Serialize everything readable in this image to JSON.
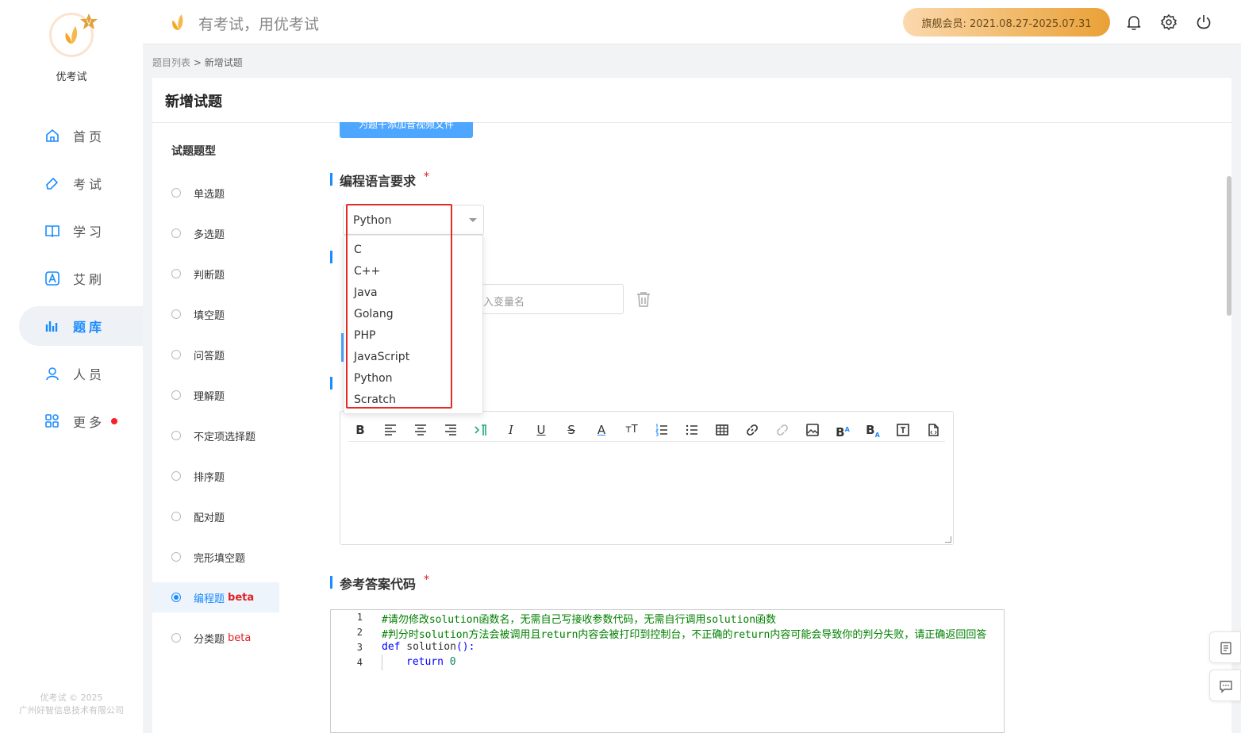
{
  "app": {
    "name": "优考试",
    "slogan": "有考试，用优考试",
    "copyright_line1": "优考试 © 2025",
    "copyright_line2": "广州好智信息技术有限公司",
    "accent_color": "#1a8cff"
  },
  "header": {
    "member_label": "旗舰会员: 2021.08.27-2025.07.31",
    "icons": [
      "bell-icon",
      "gear-icon",
      "power-icon"
    ]
  },
  "sidebar": {
    "items": [
      {
        "label": "首页",
        "icon": "home-icon"
      },
      {
        "label": "考试",
        "icon": "eraser-icon"
      },
      {
        "label": "学习",
        "icon": "book-icon"
      },
      {
        "label": "艾刷",
        "icon": "letter-a-icon"
      },
      {
        "label": "题库",
        "icon": "bar-chart-icon",
        "active": true
      },
      {
        "label": "人员",
        "icon": "user-icon"
      },
      {
        "label": "更多",
        "icon": "grid-icon",
        "badge": "red-dot"
      }
    ]
  },
  "breadcrumb": {
    "parent": "题目列表",
    "separator": ">",
    "current": "新增试题"
  },
  "page": {
    "title": "新增试题",
    "types_title": "试题题型",
    "types": [
      {
        "label": "单选题"
      },
      {
        "label": "多选题"
      },
      {
        "label": "判断题"
      },
      {
        "label": "填空题"
      },
      {
        "label": "问答题"
      },
      {
        "label": "理解题"
      },
      {
        "label": "不定项选择题"
      },
      {
        "label": "排序题"
      },
      {
        "label": "配对题"
      },
      {
        "label": "完形填空题"
      },
      {
        "label": "编程题",
        "beta": "beta",
        "active": true
      },
      {
        "label": "分类题",
        "beta": "beta"
      }
    ]
  },
  "form": {
    "upload_button": "为题干添加音视频文件",
    "lang_section_title": "编程语言要求",
    "required_mark": "*",
    "lang_selected": "Python",
    "lang_options": [
      "C",
      "C++",
      "Java",
      "Golang",
      "PHP",
      "JavaScript",
      "Python",
      "Scratch"
    ],
    "var_input_placeholder": "入变量名",
    "answer_section_title": "参考答案代码"
  },
  "code": {
    "line_numbers": [
      "1",
      "2",
      "3",
      "4"
    ],
    "line1": "#请勿修改solution函数名，无需自己写接收参数代码，无需自行调用solution函数",
    "line2": "#判分时solution方法会被调用且return内容会被打印到控制台，不正确的return内容可能会导致你的判分失败，请正确返回回答",
    "line3_kw": "def",
    "line3_rest": " solution",
    "line3_paren": "():",
    "line4_kw": "return",
    "line4_rest": " 0"
  },
  "toolbar": {
    "bold": "B",
    "italic": "I",
    "underline": "U",
    "strike": "S",
    "font_color": "A",
    "font_size": "тT",
    "superscript": "B",
    "subscript": "B"
  }
}
